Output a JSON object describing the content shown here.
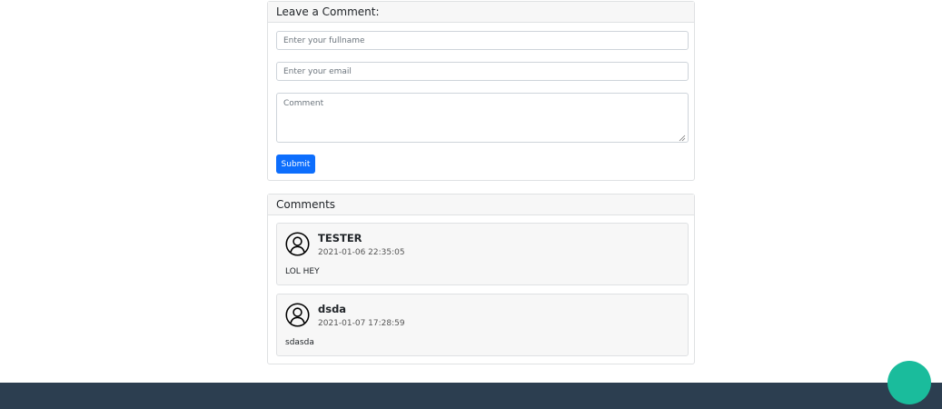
{
  "comment_form": {
    "title": "Leave a Comment:",
    "fullname_placeholder": "Enter your fullname",
    "email_placeholder": "Enter your email",
    "comment_placeholder": "Comment",
    "submit_label": "Submit"
  },
  "comments_section": {
    "title": "Comments",
    "items": [
      {
        "author": "TESTER",
        "timestamp": "2021-01-06 22:35:05",
        "text": "LOL HEY"
      },
      {
        "author": "dsda",
        "timestamp": "2021-01-07 17:28:59",
        "text": "sdasda"
      }
    ]
  },
  "icons": {
    "avatar": "user-circle-icon",
    "resize": "resize-grip-icon"
  },
  "colors": {
    "primary": "#0d6efd",
    "footer": "#2c3e50",
    "fab": "#1abc9c"
  }
}
